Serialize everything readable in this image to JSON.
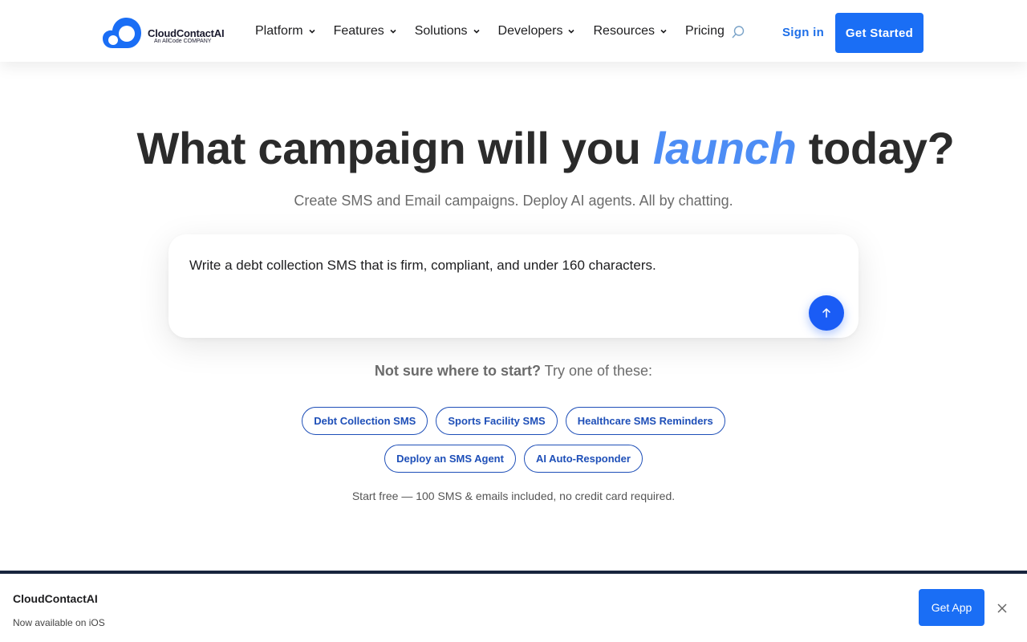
{
  "brand": {
    "name": "CloudContactAI",
    "tagline": "An AllCode COMPANY",
    "accent_color": "#1a6ef5"
  },
  "nav": {
    "items": [
      {
        "label": "Platform",
        "has_dropdown": true
      },
      {
        "label": "Features",
        "has_dropdown": true
      },
      {
        "label": "Solutions",
        "has_dropdown": true
      },
      {
        "label": "Developers",
        "has_dropdown": true
      },
      {
        "label": "Resources",
        "has_dropdown": true
      },
      {
        "label": "Pricing",
        "has_dropdown": false
      }
    ],
    "search_icon": "search-icon",
    "signin_label": "Sign in",
    "cta_label": "Get Started"
  },
  "hero": {
    "title_before": "What campaign will you",
    "title_accent": "launch",
    "title_after": "today?",
    "subtitle": "Create SMS and Email campaigns. Deploy AI agents. All by chatting."
  },
  "prompt": {
    "value": "Write a debt collection SMS that is firm, compliant, and under 160 characters.",
    "send_icon": "arrow-up-icon"
  },
  "suggestions": {
    "lead_bold": "Not sure where to start?",
    "lead_rest": "Try one of these:",
    "row1": [
      "Debt Collection SMS",
      "Sports Facility SMS",
      "Healthcare SMS Reminders"
    ],
    "row2": [
      "Deploy an SMS Agent",
      "AI Auto-Responder"
    ]
  },
  "free_note": "Start free — 100 SMS & emails included, no credit card required.",
  "banner": {
    "title": "CloudContactAI",
    "subtitle": "Now available on iOS",
    "cta_label": "Get App",
    "close_icon": "close-icon"
  }
}
